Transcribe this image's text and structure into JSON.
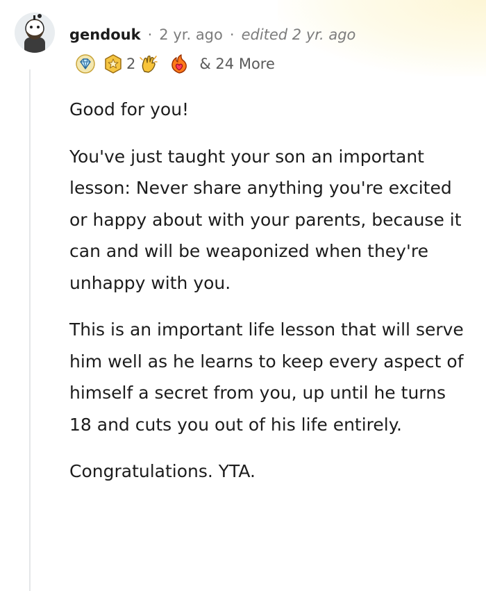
{
  "comment": {
    "author": "gendouk",
    "separator": "·",
    "time": "2 yr. ago",
    "edited": "edited 2 yr. ago",
    "awards": [
      {
        "icon": "diamond-award-icon"
      },
      {
        "icon": "gold-star-award-icon",
        "count": "2"
      },
      {
        "icon": "clapping-hands-award-icon"
      },
      {
        "icon": "fire-heart-award-icon"
      }
    ],
    "more_awards": "& 24 More",
    "paragraphs": [
      "Good for you!",
      "You've just taught your son an important lesson: Never share anything you're excited or happy about with your parents, because it can and will be weaponized when they're unhappy with you.",
      "This is an important life lesson that will serve him well as he learns to keep every aspect of himself a secret from you, up until he turns 18 and cuts you out of his life entirely.",
      "Congratulations. YTA."
    ]
  },
  "colors": {
    "text": "#1c1c1c",
    "meta": "#7c7c7c",
    "thread_line": "#e4e6e8",
    "award_gold": "#f5c542"
  }
}
